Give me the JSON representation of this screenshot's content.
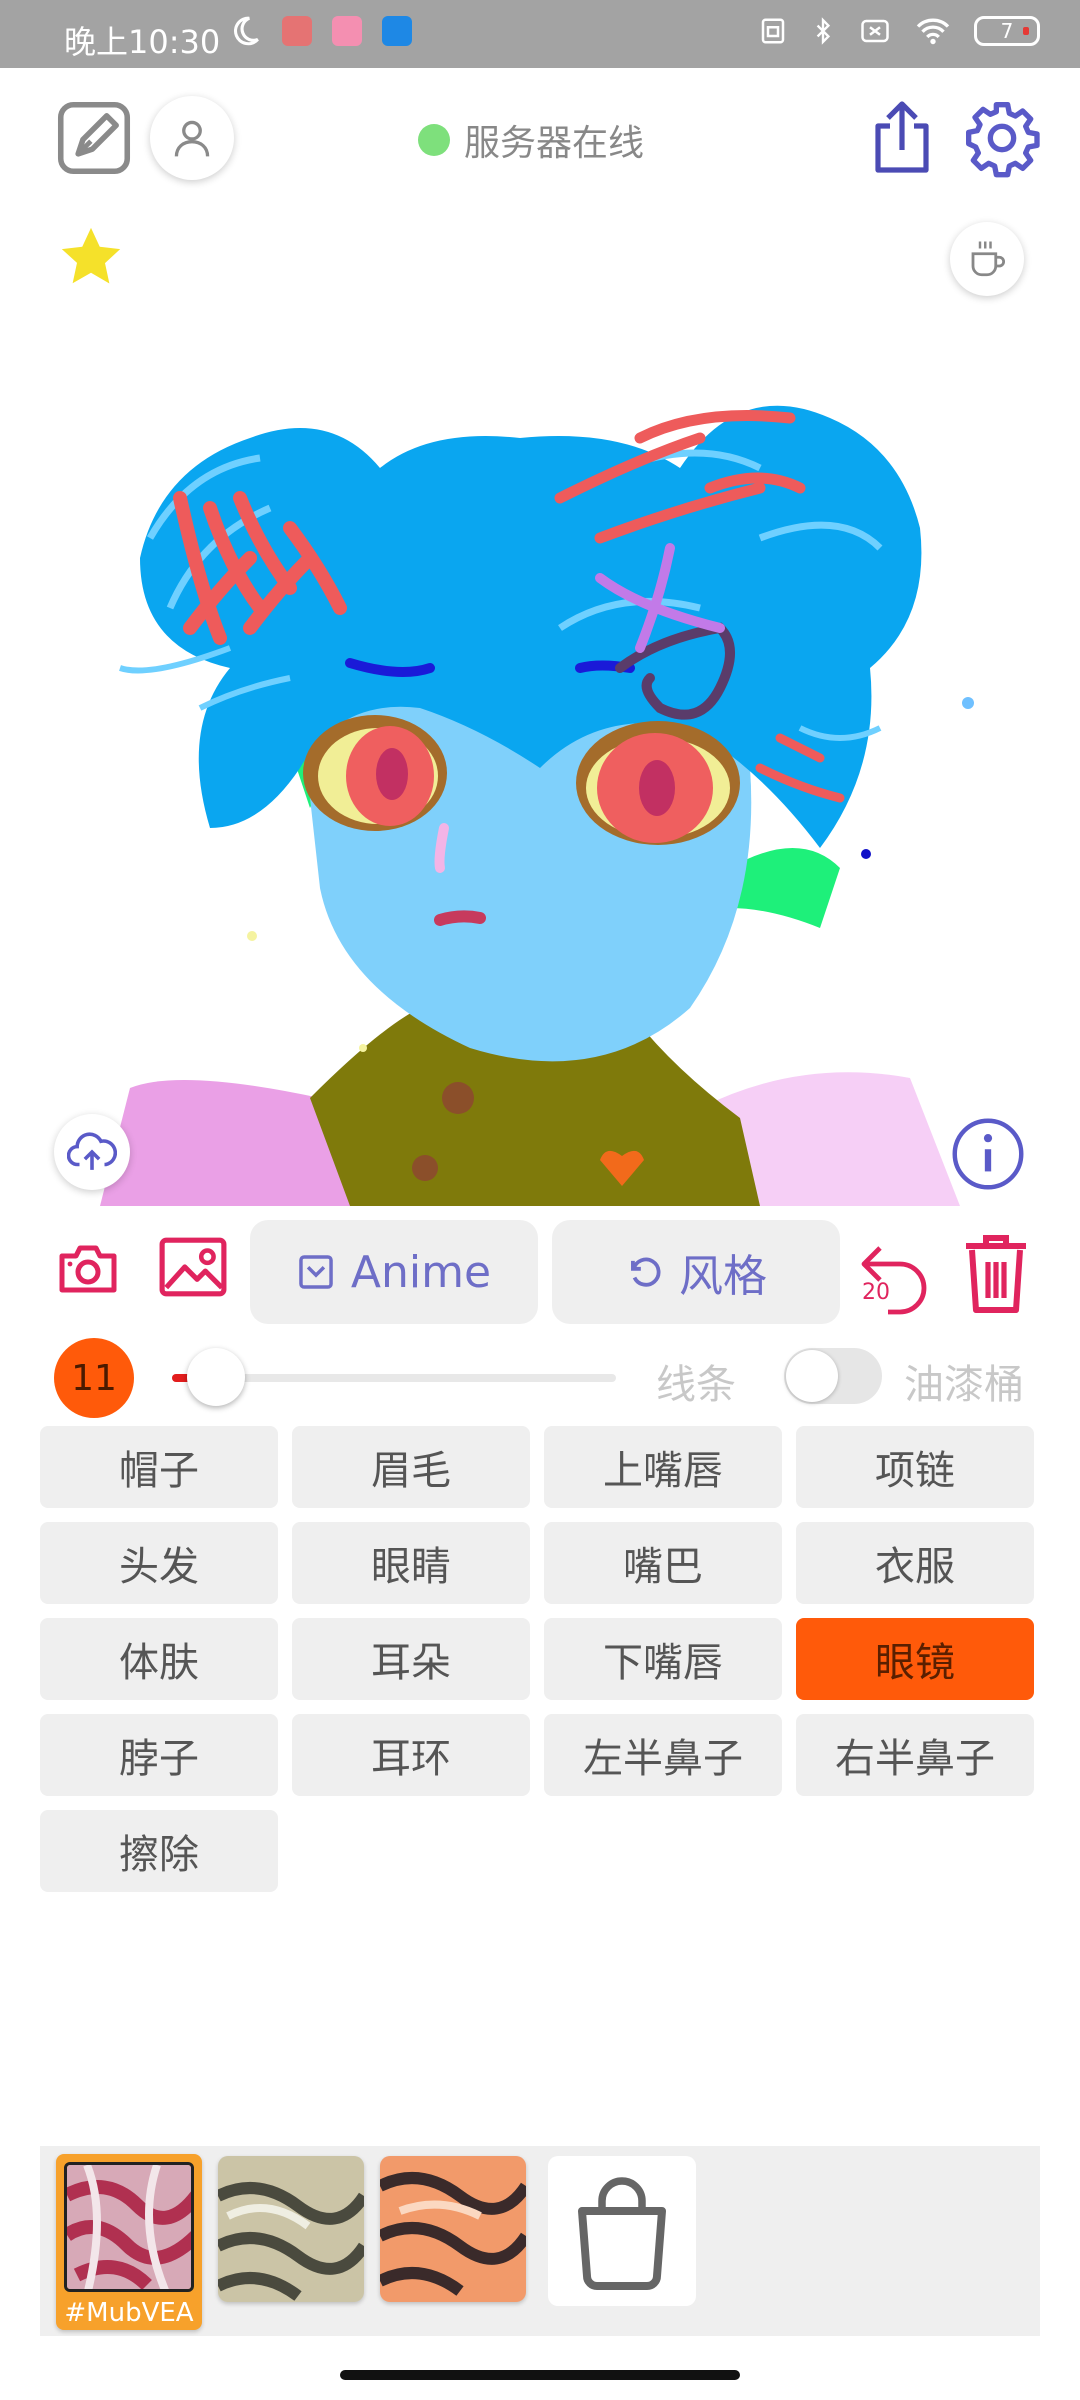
{
  "status_bar": {
    "time": "晚上10:30",
    "battery": "7"
  },
  "header": {
    "server_status": "服务器在线"
  },
  "toolbar": {
    "anime_label": "Anime",
    "style_label": "风格",
    "undo_count": "20"
  },
  "brush": {
    "size": "11",
    "size_fraction": 0.1,
    "line_label": "线条",
    "bucket_label": "油漆桶",
    "bucket_enabled": false
  },
  "parts": [
    {
      "label": "帽子"
    },
    {
      "label": "眉毛"
    },
    {
      "label": "上嘴唇"
    },
    {
      "label": "项链"
    },
    {
      "label": "头发"
    },
    {
      "label": "眼睛"
    },
    {
      "label": "嘴巴"
    },
    {
      "label": "衣服"
    },
    {
      "label": "体肤"
    },
    {
      "label": "耳朵"
    },
    {
      "label": "下嘴唇"
    },
    {
      "label": "眼镜",
      "selected": true
    },
    {
      "label": "脖子"
    },
    {
      "label": "耳环"
    },
    {
      "label": "左半鼻子"
    },
    {
      "label": "右半鼻子"
    },
    {
      "label": "擦除"
    }
  ],
  "styles": {
    "selected_label": "#MubVEA"
  },
  "colors": {
    "accent": "#ff5a0a",
    "icon_red": "#e0245e",
    "icon_purple": "#6e6ec7",
    "server_online": "#7ee07c"
  }
}
